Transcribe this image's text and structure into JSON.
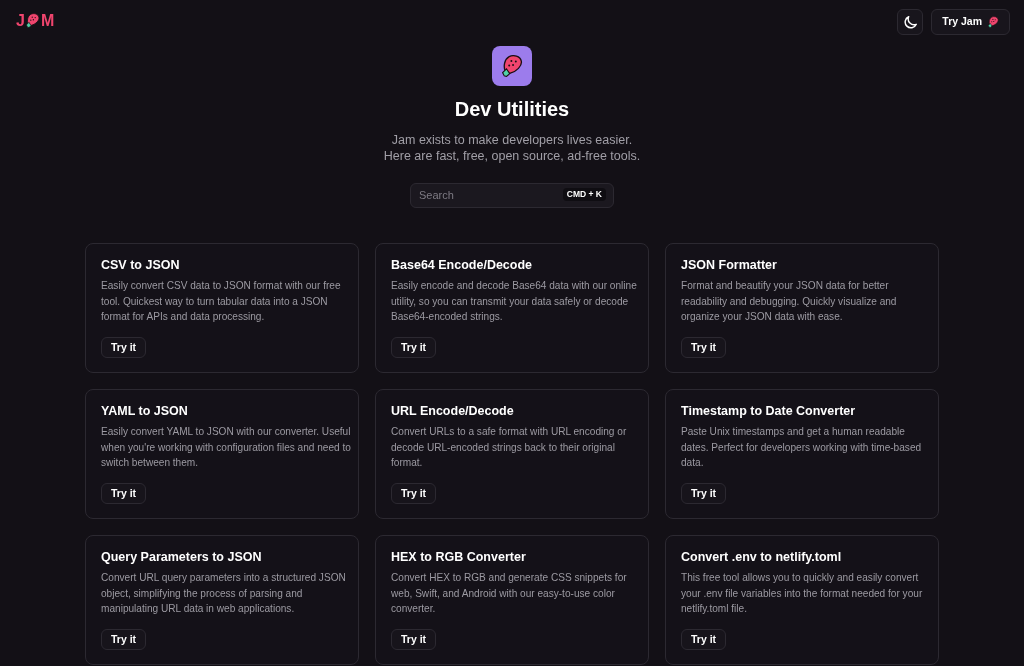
{
  "header": {
    "logo_letters": [
      "J",
      "M"
    ],
    "cta_button": "Try Jam"
  },
  "hero": {
    "title": "Dev Utilities",
    "subtitle": [
      "Jam exists to make developers lives easier.",
      "Here are fast, free, open source, ad-free tools."
    ],
    "search": {
      "placeholder": "Search",
      "shortcut": "CMD + K"
    }
  },
  "tools": [
    {
      "title": "CSV to JSON",
      "description": "Easily convert CSV data to JSON format with our free tool. Quickest way to turn tabular data into a JSON format for APIs and data processing.",
      "button": "Try it"
    },
    {
      "title": "Base64 Encode/Decode",
      "description": "Easily encode and decode Base64 data with our online utility, so you can transmit your data safely or decode Base64-encoded strings.",
      "button": "Try it"
    },
    {
      "title": "JSON Formatter",
      "description": "Format and beautify your JSON data for better readability and debugging. Quickly visualize and organize your JSON data with ease.",
      "button": "Try it"
    },
    {
      "title": "YAML to JSON",
      "description": "Easily convert YAML to JSON with our converter. Useful when you're working with configuration files and need to switch between them.",
      "button": "Try it"
    },
    {
      "title": "URL Encode/Decode",
      "description": "Convert URLs to a safe format with URL encoding or decode URL-encoded strings back to their original format.",
      "button": "Try it"
    },
    {
      "title": "Timestamp to Date Converter",
      "description": "Paste Unix timestamps and get a human readable dates. Perfect for developers working with time-based data.",
      "button": "Try it"
    },
    {
      "title": "Query Parameters to JSON",
      "description": "Convert URL query parameters into a structured JSON object, simplifying the process of parsing and manipulating URL data in web applications.",
      "button": "Try it"
    },
    {
      "title": "HEX to RGB Converter",
      "description": "Convert HEX to RGB and generate CSS snippets for web, Swift, and Android with our easy-to-use color converter.",
      "button": "Try it"
    },
    {
      "title": "Convert .env to netlify.toml",
      "description": "This free tool allows you to quickly and easily convert your .env file variables into the format needed for your netlify.toml file.",
      "button": "Try it"
    }
  ]
}
